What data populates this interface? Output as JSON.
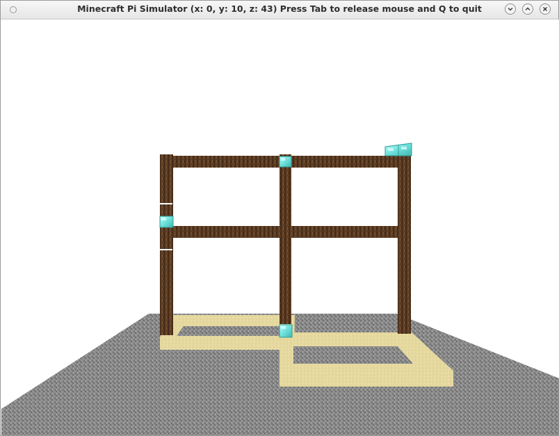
{
  "window": {
    "title": "Minecraft Pi Simulator (x: 0, y: 10, z: 43) Press Tab to release mouse and Q to quit",
    "controls": [
      "minimize",
      "maximize",
      "close"
    ]
  },
  "scene": {
    "sky_color": "#ffffff",
    "ground_color": "#8c8c8c",
    "sand_color": "#e8dca0",
    "wood_color": "#5a3a22",
    "diamond_color": "#7fe6e0",
    "materials": [
      "stone-ground",
      "sand-path",
      "wood-frame",
      "diamond-block"
    ]
  }
}
